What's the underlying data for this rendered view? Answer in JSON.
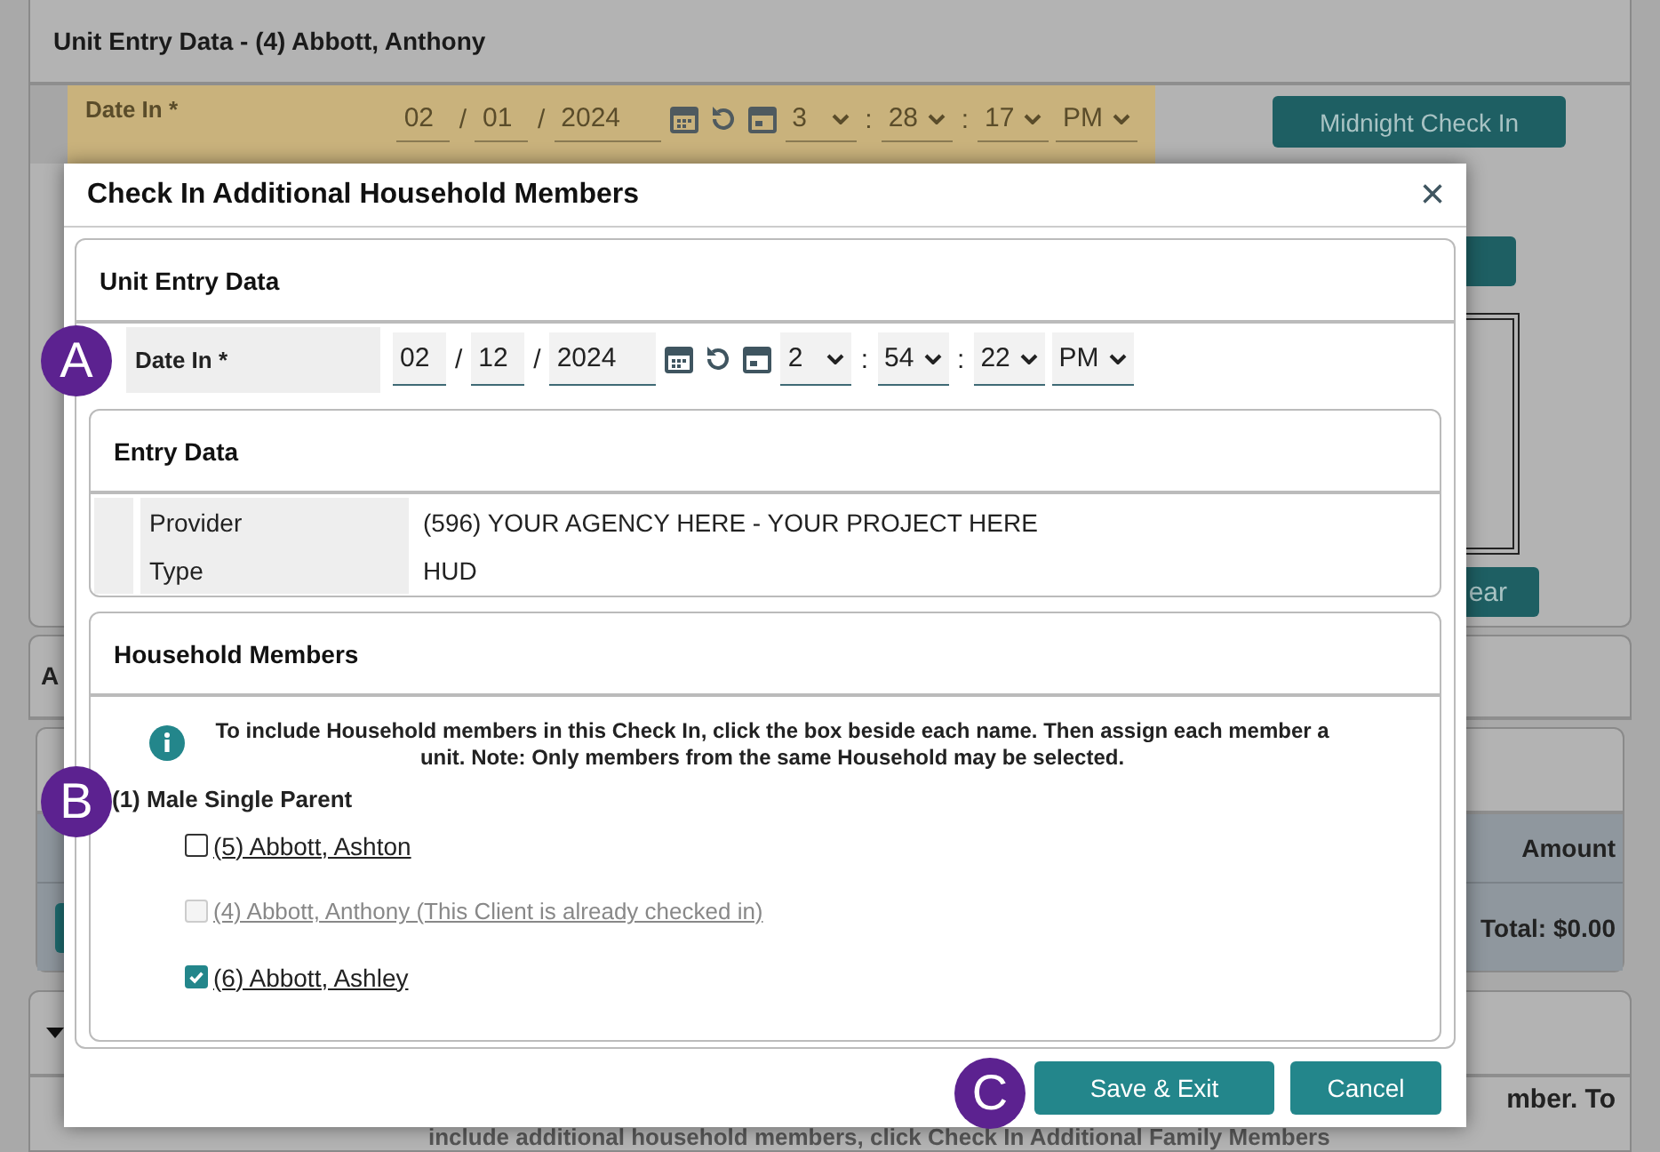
{
  "background": {
    "title": "Unit Entry Data - (4) Abbott, Anthony",
    "date_label": "Date In *",
    "date_time": [
      {
        "kind": "field",
        "text": "02"
      },
      {
        "kind": "separator",
        "text": "/"
      },
      {
        "kind": "field",
        "text": "01"
      },
      {
        "kind": "separator",
        "text": "/"
      },
      {
        "kind": "year",
        "text": "2024"
      },
      {
        "kind": "calendar"
      },
      {
        "kind": "reset"
      },
      {
        "kind": "today"
      },
      {
        "kind": "select",
        "text": "3"
      },
      {
        "kind": "separator",
        "text": ":"
      },
      {
        "kind": "select",
        "text": "28"
      },
      {
        "kind": "separator",
        "text": ":"
      },
      {
        "kind": "select",
        "text": "17"
      },
      {
        "kind": "select",
        "text": "PM"
      }
    ],
    "midnight_button": "Midnight Check In",
    "clear_button": "ear",
    "section_label": "A",
    "amount_header": "Amount",
    "total": "Total: $0.00",
    "note_fragment": "mber. To",
    "note_line": "include additional household members, click Check In Additional Family Members"
  },
  "dialog": {
    "title": "Check In Additional Household Members",
    "close": "×",
    "section_title": "Unit Entry Data",
    "date_label": "Date In *",
    "date_time": [
      {
        "kind": "field",
        "text": "02"
      },
      {
        "kind": "separator",
        "text": "/"
      },
      {
        "kind": "field",
        "text": "12"
      },
      {
        "kind": "separator",
        "text": "/"
      },
      {
        "kind": "year",
        "text": "2024"
      },
      {
        "kind": "calendar"
      },
      {
        "kind": "reset"
      },
      {
        "kind": "today"
      },
      {
        "kind": "select",
        "text": "2"
      },
      {
        "kind": "separator",
        "text": ":"
      },
      {
        "kind": "select",
        "text": "54"
      },
      {
        "kind": "separator",
        "text": ":"
      },
      {
        "kind": "select",
        "text": "22"
      },
      {
        "kind": "select",
        "text": "PM"
      }
    ],
    "entry_data": {
      "title": "Entry Data",
      "rows": [
        {
          "label": "Provider",
          "value": "(596) YOUR AGENCY HERE - YOUR PROJECT HERE"
        },
        {
          "label": "Type",
          "value": "HUD"
        }
      ]
    },
    "household": {
      "title": "Household Members",
      "info": "To include Household members in this Check In, click the box beside each name. Then assign each member a unit. Note: Only members from the same Household may be selected.",
      "group": "(1) Male Single Parent",
      "members": [
        {
          "label": "(5) Abbott, Ashton",
          "checked": false,
          "disabled": false
        },
        {
          "label": "(4) Abbott, Anthony (This Client is already checked in)",
          "checked": false,
          "disabled": true
        },
        {
          "label": "(6) Abbott, Ashley",
          "checked": true,
          "disabled": false
        }
      ]
    },
    "buttons": [
      "Save & Exit",
      "Cancel"
    ]
  },
  "callouts": [
    "A",
    "B",
    "C"
  ]
}
